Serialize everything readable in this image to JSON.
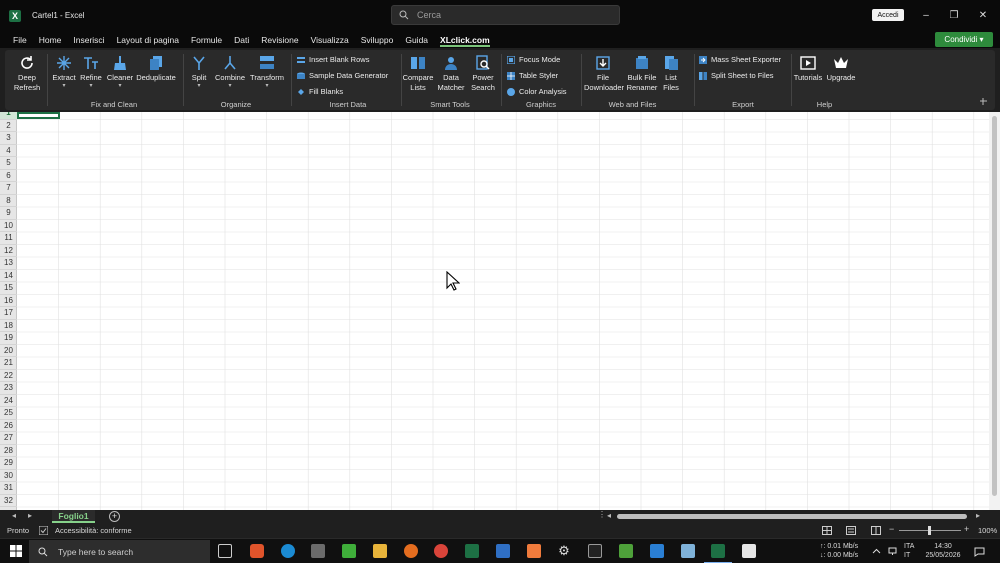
{
  "window": {
    "doc_title": "Cartel1  -  Excel",
    "search_placeholder": "Cerca",
    "signin_label": "Accedi",
    "minimize": "–",
    "maximize": "❐",
    "close": "✕"
  },
  "menu": {
    "tabs": [
      "File",
      "Home",
      "Inserisci",
      "Layout di pagina",
      "Formule",
      "Dati",
      "Revisione",
      "Visualizza",
      "Sviluppo",
      "Guida",
      "XLclick.com"
    ],
    "active_tab": "XLclick.com",
    "share_label": "Condividi ▾"
  },
  "ribbon": {
    "groups": {
      "fix_clean": "Fix and Clean",
      "organize": "Organize",
      "insert_data": "Insert Data",
      "smart_tools": "Smart Tools",
      "graphics": "Graphics",
      "web_files": "Web and Files",
      "export": "Export",
      "help": "Help"
    },
    "buttons": {
      "deep_refresh_1": "Deep",
      "deep_refresh_2": "Refresh",
      "extract": "Extract",
      "refine": "Refine",
      "cleaner": "Cleaner",
      "deduplicate": "Deduplicate",
      "split": "Split",
      "combine": "Combine",
      "transform": "Transform",
      "insert_blank_rows": "Insert Blank Rows",
      "sample_data_generator": "Sample Data Generator",
      "fill_blanks": "Fill Blanks",
      "compare_lists_1": "Compare",
      "compare_lists_2": "Lists",
      "data_matcher_1": "Data",
      "data_matcher_2": "Matcher",
      "power_search_1": "Power",
      "power_search_2": "Search",
      "focus_mode": "Focus Mode",
      "table_styler": "Table Styler",
      "color_analysis": "Color Analysis",
      "file_downloader_1": "File",
      "file_downloader_2": "Downloader",
      "bulk_file_renamer_1": "Bulk File",
      "bulk_file_renamer_2": "Renamer",
      "list_files_1": "List",
      "list_files_2": "Files",
      "mass_sheet_exporter": "Mass Sheet Exporter",
      "split_sheet_to_files": "Split Sheet to Files",
      "tutorials": "Tutorials",
      "upgrade": "Upgrade"
    }
  },
  "grid": {
    "rows": [
      "1",
      "2",
      "3",
      "4",
      "5",
      "6",
      "7",
      "8",
      "9",
      "10",
      "11",
      "12",
      "13",
      "14",
      "15",
      "16",
      "17",
      "18",
      "19",
      "20",
      "21",
      "22",
      "23",
      "24",
      "25",
      "26",
      "27",
      "28",
      "29",
      "30",
      "31",
      "32"
    ]
  },
  "sheets": {
    "active": "Foglio1",
    "add": "+"
  },
  "status": {
    "ready": "Pronto",
    "accessibility": "Accessibilità: conforme",
    "zoom": "100%"
  },
  "taskbar": {
    "search_placeholder": "Type here to search",
    "net_up": "↑: 0.01 Mb/s",
    "net_down": "↓: 0.00 Mb/s",
    "lang_1": "ITA",
    "lang_2": "IT",
    "time": "14:30",
    "date": "25/05/2026"
  },
  "colors": {
    "excel_green": "#1d7044",
    "accent_green": "#86d18a",
    "share_green": "#2e8b3c",
    "ribbon_bg": "#2a2a2a"
  }
}
